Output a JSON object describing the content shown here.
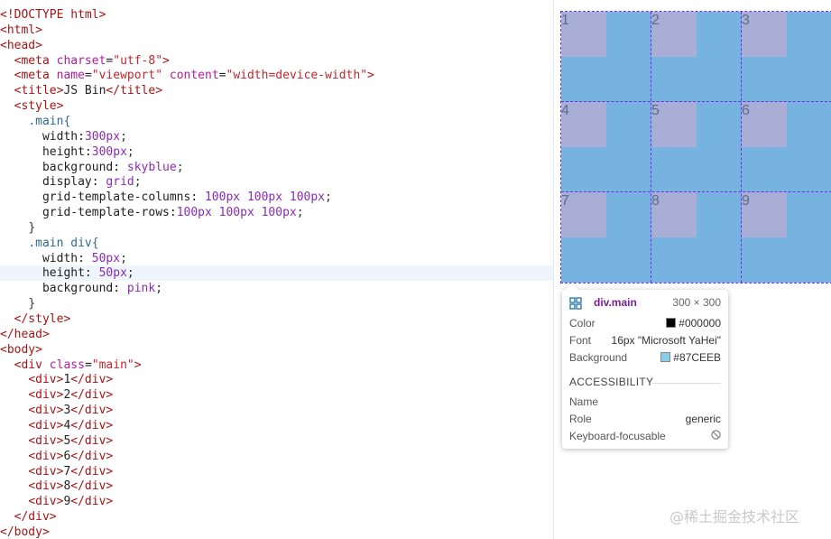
{
  "editor": {
    "lines": [
      [
        {
          "c": "tag",
          "t": "<!DOCTYPE html>"
        }
      ],
      [
        {
          "c": "tag",
          "t": "<html>"
        }
      ],
      [
        {
          "c": "tag",
          "t": "<head>"
        }
      ],
      [
        {
          "c": "tx",
          "t": "  "
        },
        {
          "c": "tag",
          "t": "<meta "
        },
        {
          "c": "at",
          "t": "charset"
        },
        {
          "c": "tx",
          "t": "="
        },
        {
          "c": "av",
          "t": "\"utf-8\""
        },
        {
          "c": "tag",
          "t": ">"
        }
      ],
      [
        {
          "c": "tx",
          "t": "  "
        },
        {
          "c": "tag",
          "t": "<meta "
        },
        {
          "c": "at",
          "t": "name"
        },
        {
          "c": "tx",
          "t": "="
        },
        {
          "c": "av",
          "t": "\"viewport\""
        },
        {
          "c": "tx",
          "t": " "
        },
        {
          "c": "at",
          "t": "content"
        },
        {
          "c": "tx",
          "t": "="
        },
        {
          "c": "av",
          "t": "\"width=device-width\""
        },
        {
          "c": "tag",
          "t": ">"
        }
      ],
      [
        {
          "c": "tx",
          "t": "  "
        },
        {
          "c": "tag",
          "t": "<title>"
        },
        {
          "c": "tx",
          "t": "JS Bin"
        },
        {
          "c": "tag",
          "t": "</title>"
        }
      ],
      [
        {
          "c": "tx",
          "t": "  "
        },
        {
          "c": "tag",
          "t": "<style>"
        }
      ],
      [
        {
          "c": "tx",
          "t": "    "
        },
        {
          "c": "sel",
          "t": ".main{"
        }
      ],
      [
        {
          "c": "tx",
          "t": "      "
        },
        {
          "c": "pr",
          "t": "width:"
        },
        {
          "c": "num",
          "t": "300px"
        },
        {
          "c": "pn",
          "t": ";"
        }
      ],
      [
        {
          "c": "tx",
          "t": "      "
        },
        {
          "c": "pr",
          "t": "height:"
        },
        {
          "c": "num",
          "t": "300px"
        },
        {
          "c": "pn",
          "t": ";"
        }
      ],
      [
        {
          "c": "tx",
          "t": "      "
        },
        {
          "c": "pr",
          "t": "background: "
        },
        {
          "c": "kw",
          "t": "skyblue"
        },
        {
          "c": "pn",
          "t": ";"
        }
      ],
      [
        {
          "c": "tx",
          "t": "      "
        },
        {
          "c": "pr",
          "t": "display: "
        },
        {
          "c": "kw",
          "t": "grid"
        },
        {
          "c": "pn",
          "t": ";"
        }
      ],
      [
        {
          "c": "tx",
          "t": "      "
        },
        {
          "c": "pr",
          "t": "grid-template-columns: "
        },
        {
          "c": "num",
          "t": "100px 100px 100px"
        },
        {
          "c": "pn",
          "t": ";"
        }
      ],
      [
        {
          "c": "tx",
          "t": "      "
        },
        {
          "c": "pr",
          "t": "grid-template-rows:"
        },
        {
          "c": "num",
          "t": "100px 100px 100px"
        },
        {
          "c": "pn",
          "t": ";"
        }
      ],
      [
        {
          "c": "tx",
          "t": "    "
        },
        {
          "c": "pn",
          "t": "}"
        }
      ],
      [
        {
          "c": "tx",
          "t": "    "
        },
        {
          "c": "sel",
          "t": ".main div{"
        }
      ],
      [
        {
          "c": "tx",
          "t": "      "
        },
        {
          "c": "pr",
          "t": "width: "
        },
        {
          "c": "num",
          "t": "50px"
        },
        {
          "c": "pn",
          "t": ";"
        }
      ],
      [
        {
          "c": "tx",
          "t": "      "
        },
        {
          "c": "pr",
          "t": "height: "
        },
        {
          "c": "num",
          "t": "50px"
        },
        {
          "c": "pn",
          "t": ";"
        }
      ],
      [
        {
          "c": "tx",
          "t": "      "
        },
        {
          "c": "pr",
          "t": "background: "
        },
        {
          "c": "kw",
          "t": "pink"
        },
        {
          "c": "pn",
          "t": ";"
        }
      ],
      [
        {
          "c": "tx",
          "t": "    "
        },
        {
          "c": "pn",
          "t": "}"
        }
      ],
      [
        {
          "c": "tx",
          "t": "  "
        },
        {
          "c": "tag",
          "t": "</style>"
        }
      ],
      [
        {
          "c": "tag",
          "t": "</head>"
        }
      ],
      [
        {
          "c": "tag",
          "t": "<body>"
        }
      ],
      [
        {
          "c": "tx",
          "t": "  "
        },
        {
          "c": "tag",
          "t": "<div "
        },
        {
          "c": "at",
          "t": "class"
        },
        {
          "c": "tx",
          "t": "="
        },
        {
          "c": "av",
          "t": "\"main\""
        },
        {
          "c": "tag",
          "t": ">"
        }
      ],
      [
        {
          "c": "tx",
          "t": "    "
        },
        {
          "c": "tag",
          "t": "<div>"
        },
        {
          "c": "tx",
          "t": "1"
        },
        {
          "c": "tag",
          "t": "</div>"
        }
      ],
      [
        {
          "c": "tx",
          "t": "    "
        },
        {
          "c": "tag",
          "t": "<div>"
        },
        {
          "c": "tx",
          "t": "2"
        },
        {
          "c": "tag",
          "t": "</div>"
        }
      ],
      [
        {
          "c": "tx",
          "t": "    "
        },
        {
          "c": "tag",
          "t": "<div>"
        },
        {
          "c": "tx",
          "t": "3"
        },
        {
          "c": "tag",
          "t": "</div>"
        }
      ],
      [
        {
          "c": "tx",
          "t": "    "
        },
        {
          "c": "tag",
          "t": "<div>"
        },
        {
          "c": "tx",
          "t": "4"
        },
        {
          "c": "tag",
          "t": "</div>"
        }
      ],
      [
        {
          "c": "tx",
          "t": "    "
        },
        {
          "c": "tag",
          "t": "<div>"
        },
        {
          "c": "tx",
          "t": "5"
        },
        {
          "c": "tag",
          "t": "</div>"
        }
      ],
      [
        {
          "c": "tx",
          "t": "    "
        },
        {
          "c": "tag",
          "t": "<div>"
        },
        {
          "c": "tx",
          "t": "6"
        },
        {
          "c": "tag",
          "t": "</div>"
        }
      ],
      [
        {
          "c": "tx",
          "t": "    "
        },
        {
          "c": "tag",
          "t": "<div>"
        },
        {
          "c": "tx",
          "t": "7"
        },
        {
          "c": "tag",
          "t": "</div>"
        }
      ],
      [
        {
          "c": "tx",
          "t": "    "
        },
        {
          "c": "tag",
          "t": "<div>"
        },
        {
          "c": "tx",
          "t": "8"
        },
        {
          "c": "tag",
          "t": "</div>"
        }
      ],
      [
        {
          "c": "tx",
          "t": "    "
        },
        {
          "c": "tag",
          "t": "<div>"
        },
        {
          "c": "tx",
          "t": "9"
        },
        {
          "c": "tag",
          "t": "</div>"
        }
      ],
      [
        {
          "c": "tx",
          "t": "  "
        },
        {
          "c": "tag",
          "t": "</div>"
        }
      ],
      [
        {
          "c": "tag",
          "t": "</body>"
        }
      ]
    ]
  },
  "preview": {
    "cells": [
      "1",
      "2",
      "3",
      "4",
      "5",
      "6",
      "7",
      "8",
      "9"
    ],
    "container_color": "#76b3e0",
    "cell_color": "#a8aed6"
  },
  "tooltip": {
    "icon": "grid-icon",
    "element": "div.main",
    "size": "300 × 300",
    "color_label": "Color",
    "color_value": "#000000",
    "font_label": "Font",
    "font_value": "16px \"Microsoft YaHei\"",
    "background_label": "Background",
    "background_value": "#87CEEB",
    "accessibility_heading": "ACCESSIBILITY",
    "name_label": "Name",
    "role_label": "Role",
    "role_value": "generic",
    "keyboard_label": "Keyboard-focusable",
    "keyboard_icon": "no-entry-icon"
  },
  "watermark": "@稀土掘金技术社区"
}
